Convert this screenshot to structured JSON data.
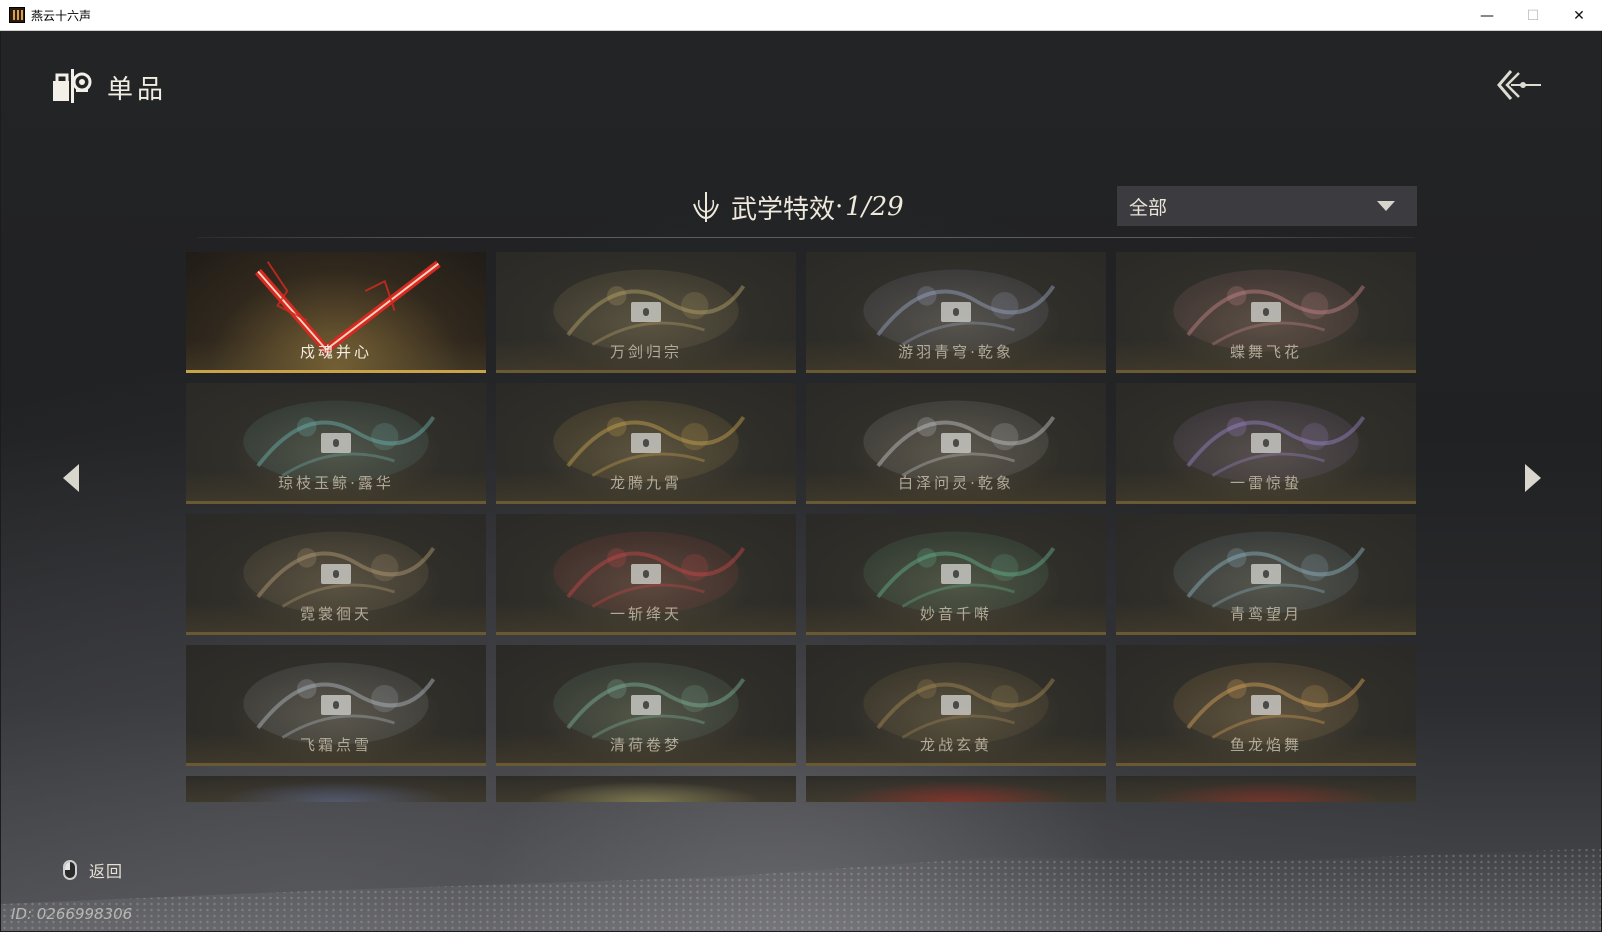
{
  "window": {
    "title": "燕云十六声",
    "min_glyph": "—",
    "max_glyph": "☐",
    "close_glyph": "✕"
  },
  "header": {
    "title": "单品"
  },
  "section": {
    "title": "武学特效",
    "separator": "·",
    "count": "1/29"
  },
  "filter": {
    "selected": "全部"
  },
  "items": [
    {
      "name": "戍魂并心",
      "owned": true,
      "color": "#d42a1f",
      "icon": "crossed-blades-red"
    },
    {
      "name": "万剑归宗",
      "owned": false,
      "color": "#b9a36a",
      "icon": "swords"
    },
    {
      "name": "游羽青穹·乾象",
      "owned": false,
      "color": "#9aa7c4",
      "icon": "phoenix"
    },
    {
      "name": "蝶舞飞花",
      "owned": false,
      "color": "#c7868a",
      "icon": "butterfly"
    },
    {
      "name": "琼枝玉鲸·露华",
      "owned": false,
      "color": "#6fb3b0",
      "icon": "whale"
    },
    {
      "name": "龙腾九霄",
      "owned": false,
      "color": "#c9a34f",
      "icon": "dragon"
    },
    {
      "name": "白泽问灵·乾象",
      "owned": false,
      "color": "#c6c6c6",
      "icon": "deer"
    },
    {
      "name": "一雷惊蛰",
      "owned": false,
      "color": "#9a86c9",
      "icon": "lightning"
    },
    {
      "name": "霓裳徊天",
      "owned": false,
      "color": "#b59d76",
      "icon": "moon-dancer"
    },
    {
      "name": "一斩绛天",
      "owned": false,
      "color": "#c9474a",
      "icon": "slash-red"
    },
    {
      "name": "妙音千啭",
      "owned": false,
      "color": "#63b18c",
      "icon": "bird-green"
    },
    {
      "name": "青鸾望月",
      "owned": false,
      "color": "#8fb5c4",
      "icon": "fan-blue"
    },
    {
      "name": "飞霜点雪",
      "owned": false,
      "color": "#b5bcc6",
      "icon": "pavilion"
    },
    {
      "name": "清荷卷梦",
      "owned": false,
      "color": "#7fb59a",
      "icon": "lotus"
    },
    {
      "name": "龙战玄黄",
      "owned": false,
      "color": "#a78a55",
      "icon": "dragon-ring"
    },
    {
      "name": "鱼龙焰舞",
      "owned": false,
      "color": "#d7a35a",
      "icon": "koi"
    }
  ],
  "partial_row_colors": [
    "#4f5f8a",
    "#8a8a60",
    "#8e2a2a",
    "#7a2a2a"
  ],
  "bottom": {
    "back_label": "返回",
    "user_id": "ID: 0266998306"
  }
}
